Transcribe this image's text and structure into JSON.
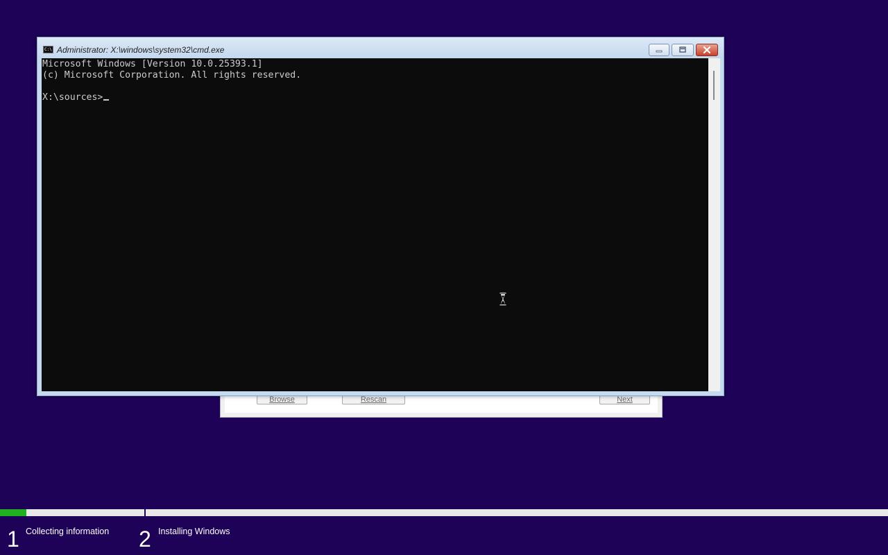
{
  "setup_dialog": {
    "browse_label": "Browse",
    "rescan_label": "Rescan",
    "next_label": "Next"
  },
  "cmd_window": {
    "title": "Administrator: X:\\windows\\system32\\cmd.exe",
    "icon_text": "C:\\",
    "console_lines": [
      "Microsoft Windows [Version 10.0.25393.1]",
      "(c) Microsoft Corporation. All rights reserved.",
      "",
      "X:\\sources>"
    ]
  },
  "progress": {
    "fraction": 0.03,
    "steps": [
      {
        "number": "1",
        "label": "Collecting information"
      },
      {
        "number": "2",
        "label": "Installing Windows"
      }
    ]
  },
  "colors": {
    "background": "#1e0258",
    "progress_fill": "#20b020",
    "console_bg": "#0c0c0c",
    "console_text": "#cccccc"
  },
  "icons": [
    "cmd-icon",
    "minimize-icon",
    "maximize-icon",
    "close-icon",
    "hourglass-cursor-icon"
  ]
}
